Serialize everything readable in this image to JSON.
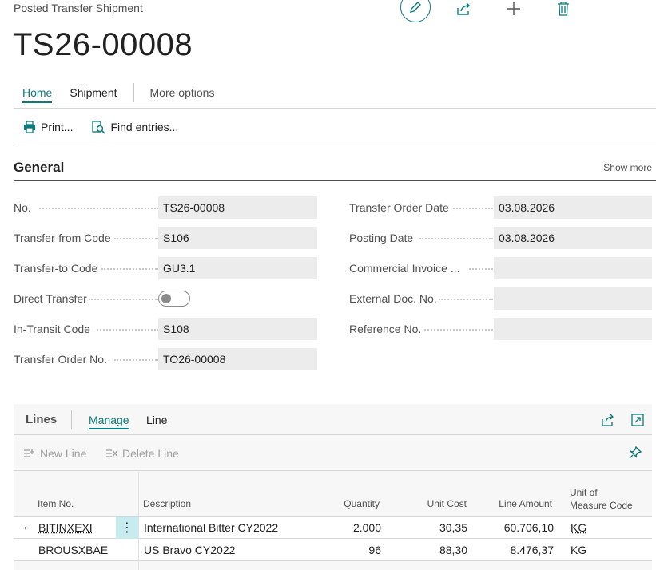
{
  "header": {
    "caption": "Posted Transfer Shipment",
    "title": "TS26-00008"
  },
  "tabs": [
    {
      "label": "Home"
    },
    {
      "label": "Shipment"
    },
    {
      "label": "More options"
    }
  ],
  "actions": {
    "print": "Print...",
    "find_entries": "Find entries..."
  },
  "general": {
    "title": "General",
    "show_more": "Show more",
    "left": [
      {
        "label": "No.",
        "value": "TS26-00008"
      },
      {
        "label": "Transfer-from Code",
        "value": "S106"
      },
      {
        "label": "Transfer-to Code",
        "value": "GU3.1"
      },
      {
        "label": "Direct Transfer",
        "value": ""
      },
      {
        "label": "In-Transit Code",
        "value": "S108"
      },
      {
        "label": "Transfer Order No.",
        "value": "TO26-00008"
      }
    ],
    "right": [
      {
        "label": "Transfer Order Date",
        "value": "03.08.2026"
      },
      {
        "label": "Posting Date",
        "value": "03.08.2026"
      },
      {
        "label": "Commercial Invoice ...",
        "value": ""
      },
      {
        "label": "External Doc. No.",
        "value": ""
      },
      {
        "label": "Reference No.",
        "value": ""
      }
    ],
    "direct_transfer_on": false
  },
  "lines": {
    "title": "Lines",
    "tabs": [
      {
        "label": "Manage"
      },
      {
        "label": "Line"
      }
    ],
    "actions": {
      "new_line": "New Line",
      "delete_line": "Delete Line"
    },
    "columns": {
      "item_no": "Item No.",
      "description": "Description",
      "quantity": "Quantity",
      "unit_cost": "Unit Cost",
      "line_amount": "Line Amount",
      "uom_1": "Unit of",
      "uom_2": "Measure Code"
    },
    "rows": [
      {
        "item_no": "BITINXEXI",
        "description": "International Bitter CY2022",
        "quantity": "2.000",
        "unit_cost": "30,35",
        "line_amount": "60.706,10",
        "uom": "KG"
      },
      {
        "item_no": "BROUSXBAE",
        "description": "US Bravo CY2022",
        "quantity": "96",
        "unit_cost": "88,30",
        "line_amount": "8.476,37",
        "uom": "KG"
      }
    ]
  },
  "colors": {
    "accent": "#0b7a7a",
    "field_bg": "#ececed",
    "row_menu_bg": "#c7ecef"
  }
}
